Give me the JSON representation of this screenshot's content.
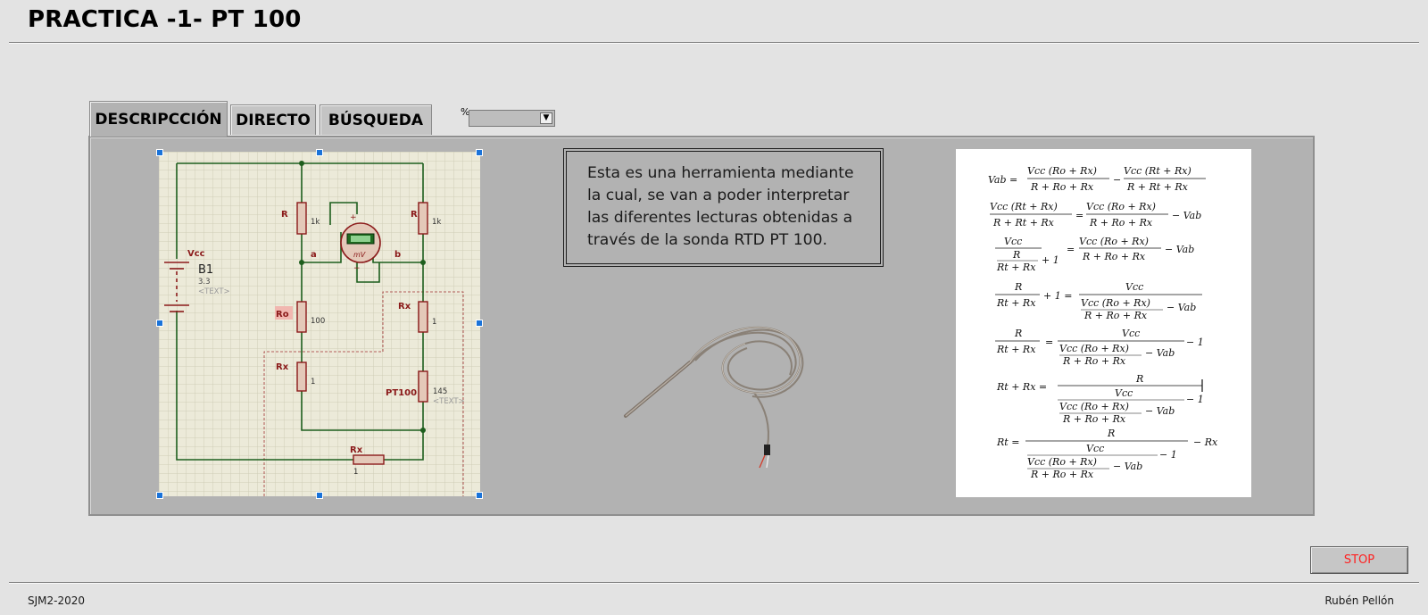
{
  "window": {
    "title": "PRACTICA -1- PT 100"
  },
  "tabs": [
    {
      "label": "DESCRIPCCIÓN",
      "active": true
    },
    {
      "label": "DIRECTO",
      "active": false
    },
    {
      "label": "BÚSQUEDA",
      "active": false
    }
  ],
  "selector": {
    "percent_symbol": "%",
    "value": ""
  },
  "circuit": {
    "source_label": "Vcc",
    "battery_name": "B1",
    "battery_value": "3.3",
    "battery_text": "<TEXT>",
    "r_left_label": "R",
    "r_left_value": "1k",
    "r_right_label": "R",
    "r_right_value": "1k",
    "node_a": "a",
    "node_b": "b",
    "meter_unit": "mV",
    "ro_label": "Ro",
    "ro_value": "100",
    "rx_left_label": "Rx",
    "rx_left_value": "1",
    "rx_right_label": "Rx",
    "rx_right_value": "1",
    "pt100_label": "PT100",
    "pt100_value": "145",
    "pt100_text": "<TEXT>",
    "rx_bottom_label": "Rx",
    "rx_bottom_value": "1"
  },
  "description": {
    "text": "Esta es una herramienta mediante la cual, se van a poder interpretar las diferentes lecturas obtenidas a través de la sonda RTD PT 100."
  },
  "formulas": {
    "eq1": {
      "lhs": "Vab =",
      "n1": "Vcc (Ro + Rx)",
      "d1": "R + Ro + Rx",
      "op": "−",
      "n2": "Vcc (Rt + Rx)",
      "d2": "R + Rt + Rx"
    },
    "eq2": {
      "n1": "Vcc (Rt + Rx)",
      "d1": "R + Rt + Rx",
      "op": "=",
      "n2": "Vcc (Ro + Rx)",
      "d2": "R + Ro + Rx",
      "tail": "− Vab"
    },
    "eq3": {
      "n1": "Vcc",
      "inner_n": "R",
      "inner_d": "Rt + Rx",
      "plus": "+ 1",
      "op": "=",
      "n2": "Vcc (Ro + Rx)",
      "d2": "R + Ro + Rx",
      "tail": "− Vab"
    },
    "eq4": {
      "n1": "R",
      "d1": "Rt + Rx",
      "plus": "+ 1 =",
      "num": "Vcc",
      "inner_n": "Vcc (Ro + Rx)",
      "inner_d": "R + Ro + Rx",
      "tail": "− Vab"
    },
    "eq5": {
      "n1": "R",
      "d1": "Rt + Rx",
      "op": "=",
      "num": "Vcc",
      "inner_n": "Vcc (Ro + Rx)",
      "inner_d": "R + Ro + Rx",
      "tail": "− Vab",
      "minus": "− 1"
    },
    "eq6": {
      "lhs": "Rt + Rx =",
      "num": "R",
      "mid": "Vcc",
      "inner_n": "Vcc (Ro + Rx)",
      "inner_d": "R + Ro + Rx",
      "tail": "− Vab",
      "minus": "− 1"
    },
    "eq7": {
      "lhs": "Rt =",
      "num": "R",
      "mid": "Vcc",
      "inner_n": "Vcc (Ro + Rx)",
      "inner_d": "R + Ro + Rx",
      "tail": "− Vab",
      "minus": "− 1",
      "end": "− Rx"
    }
  },
  "stop_button": {
    "label": "STOP",
    "color": "#ff1f1f"
  },
  "footer": {
    "left": "SJM2-2020",
    "right": "Rubén Pellón"
  },
  "colors": {
    "background": "#e3e3e3",
    "panel": "#b2b2b2",
    "wire": "#1d5e1d",
    "component": "#8b1a1a"
  }
}
